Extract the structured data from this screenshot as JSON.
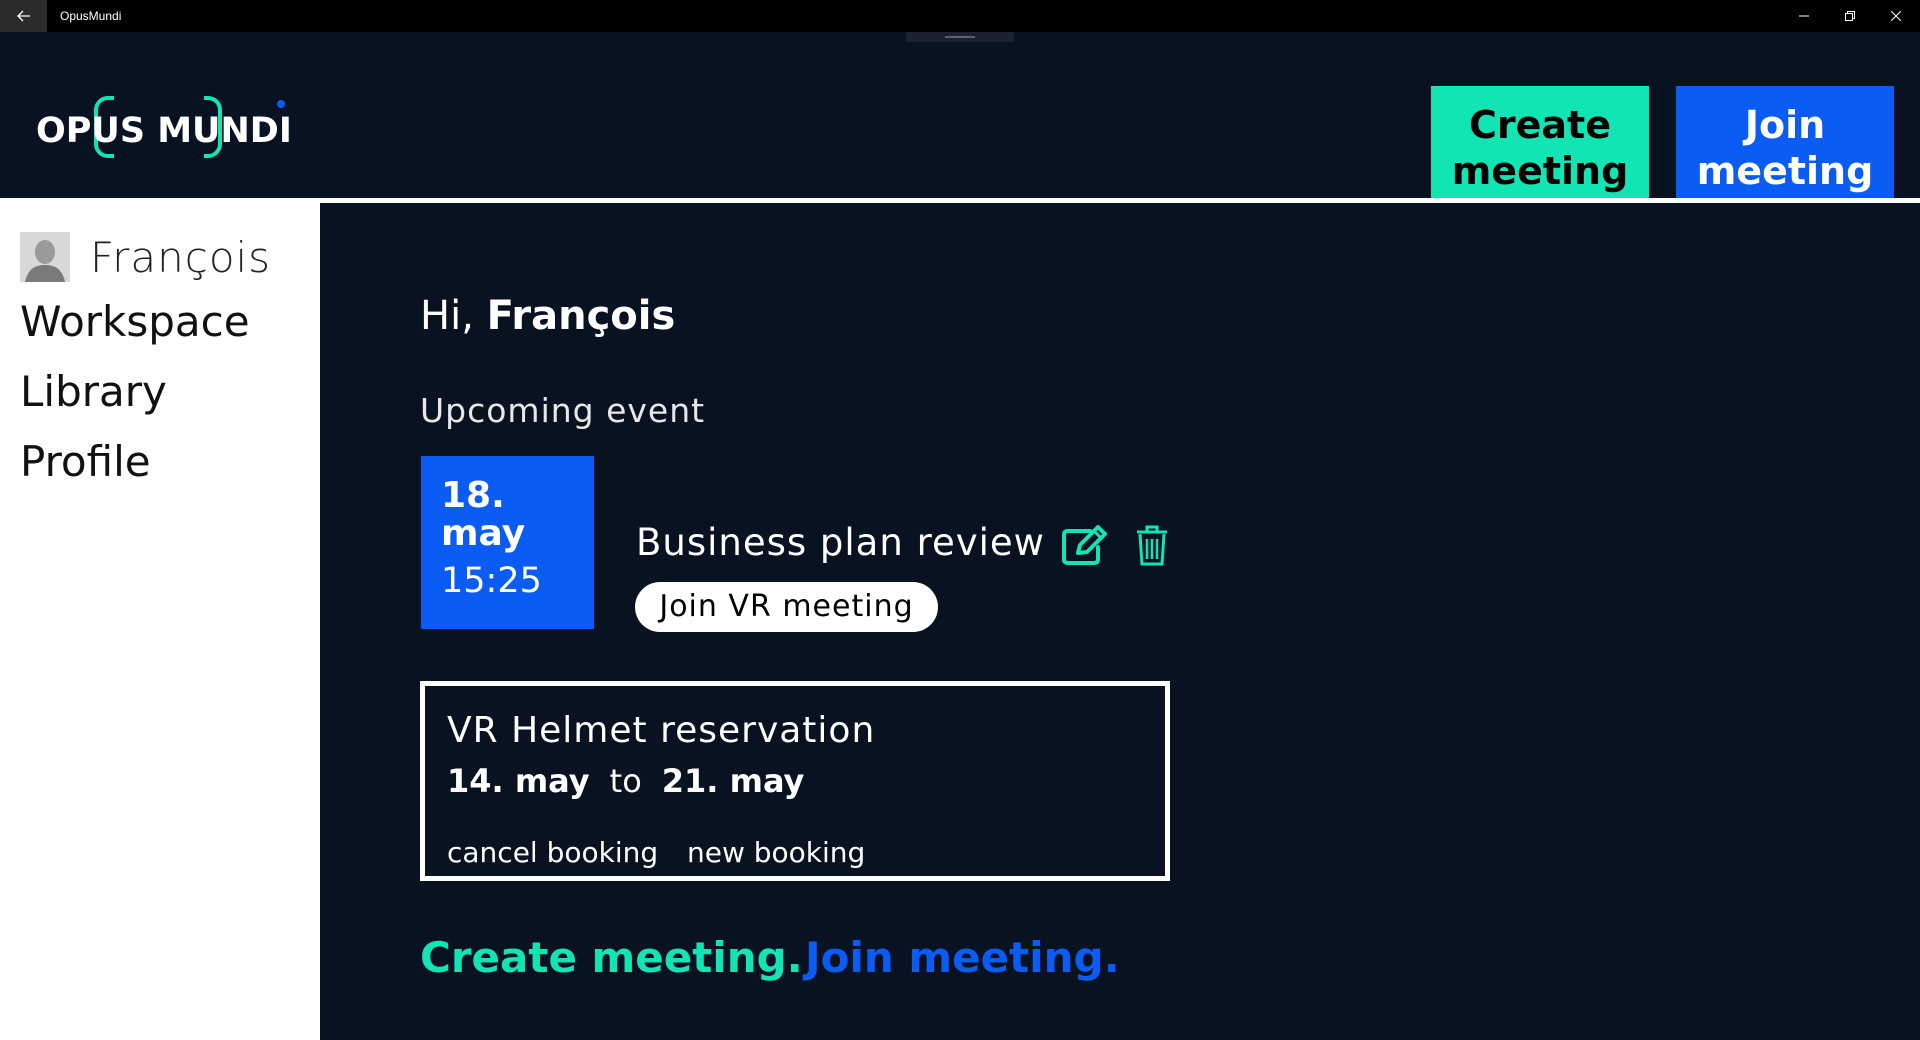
{
  "window": {
    "title": "OpusMundi",
    "back_icon": "arrow-left-icon",
    "minimize_icon": "minimize-icon",
    "maximize_icon": "restore-icon",
    "close_icon": "close-icon"
  },
  "header": {
    "logo_text": "OPUS MUNDI",
    "create_button": "Create meeting",
    "join_button": "Join meeting"
  },
  "sidebar": {
    "user_name": "François",
    "items": [
      {
        "label": "Workspace"
      },
      {
        "label": "Library"
      },
      {
        "label": "Profile"
      }
    ]
  },
  "main": {
    "greeting_prefix": "Hi, ",
    "greeting_name": "François",
    "upcoming_label": "Upcoming event",
    "event": {
      "day": "18.",
      "month": "may",
      "time": "15:25",
      "title": "Business plan review",
      "join_label": "Join VR meeting"
    },
    "booking": {
      "title": "VR Helmet reservation",
      "from": "14. may",
      "to_word": "to",
      "to": "21. may",
      "cancel_label": "cancel booking",
      "new_label": "new booking"
    },
    "footer": {
      "create_link": "Create meeting.",
      "join_link": "Join meeting."
    }
  },
  "colors": {
    "background": "#091221",
    "accent_green": "#12e5b4",
    "accent_blue": "#0a5cf5"
  }
}
